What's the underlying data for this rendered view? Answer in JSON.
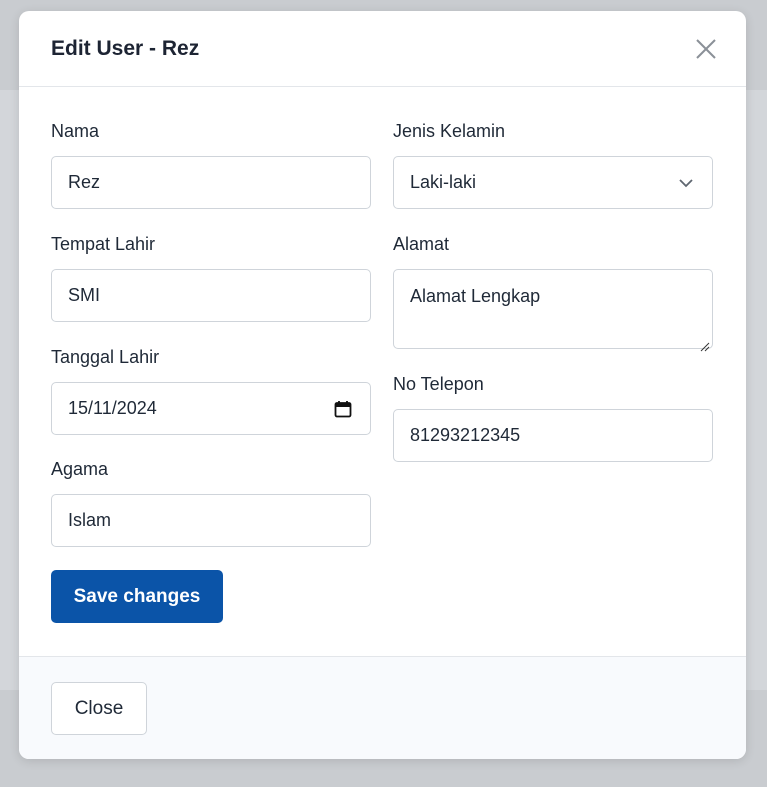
{
  "modal": {
    "title": "Edit User - Rez",
    "close_icon": "close-icon"
  },
  "form": {
    "nama": {
      "label": "Nama",
      "value": "Rez"
    },
    "tempat_lahir": {
      "label": "Tempat Lahir",
      "value": "SMI"
    },
    "tanggal_lahir": {
      "label": "Tanggal Lahir",
      "value": "15/11/2024",
      "icon": "calendar-icon"
    },
    "agama": {
      "label": "Agama",
      "value": "Islam"
    },
    "jenis_kelamin": {
      "label": "Jenis Kelamin",
      "value": "Laki-laki",
      "icon": "chevron-down-icon"
    },
    "alamat": {
      "label": "Alamat",
      "placeholder": "Alamat Lengkap"
    },
    "no_telepon": {
      "label": "No Telepon",
      "value": "81293212345"
    }
  },
  "actions": {
    "save_label": "Save changes",
    "close_label": "Close"
  },
  "colors": {
    "primary": "#0b54a8",
    "backdrop": "#c9ccd0",
    "border": "#cfd4da"
  }
}
